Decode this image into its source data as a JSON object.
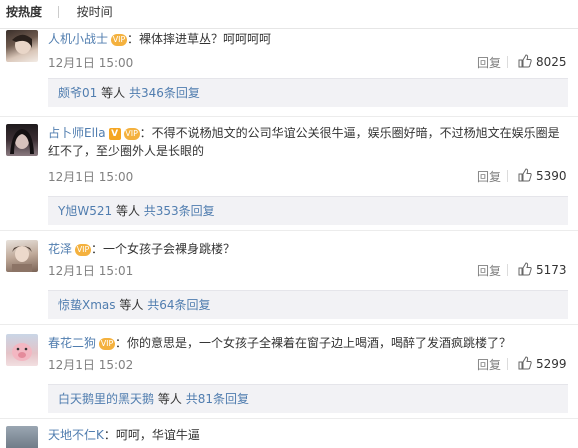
{
  "sortbar": {
    "by_hot": "按热度",
    "by_time": "按时间"
  },
  "comments": [
    {
      "user": "人机小战士",
      "badge": "vip",
      "text": "裸体摔进草丛？呵呵呵呵",
      "time": "12月1日 15:00",
      "reply": "回复",
      "likes": "8025",
      "sub_names": "颇爷01",
      "sub_wait": "等人",
      "sub_total": "共346条回复"
    },
    {
      "user": "占卜师Ella",
      "badge": "v",
      "text": "不得不说杨旭文的公司华谊公关很牛逼，娱乐圈好暗，不过杨旭文在娱乐圈是红不了，至少圈外人是长眼的",
      "time": "12月1日 15:00",
      "reply": "回复",
      "likes": "5390",
      "sub_names": "Y旭W521",
      "sub_wait": "等人",
      "sub_total": "共353条回复"
    },
    {
      "user": "花泽",
      "badge": "vip",
      "text": "一个女孩子会裸身跳楼？",
      "time": "12月1日 15:01",
      "reply": "回复",
      "likes": "5173",
      "sub_names": "惊蛰Xmas",
      "sub_wait": "等人",
      "sub_total": "共64条回复"
    },
    {
      "user": "春花二狗",
      "badge": "vip",
      "text": "你的意思是，一个女孩子全裸着在窗子边上喝酒，喝醉了发酒疯跳楼了？",
      "time": "12月1日 15:02",
      "reply": "回复",
      "likes": "5299",
      "sub_names": "白天鹅里的黑天鹅",
      "sub_wait": "等人",
      "sub_total": "共81条回复"
    },
    {
      "user": "天地不仁K",
      "badge": "",
      "text": "呵呵，华谊牛逼"
    }
  ],
  "colors": {
    "username": "#507daf",
    "meta": "#808080",
    "subbox_bg": "#f2f2f5"
  }
}
